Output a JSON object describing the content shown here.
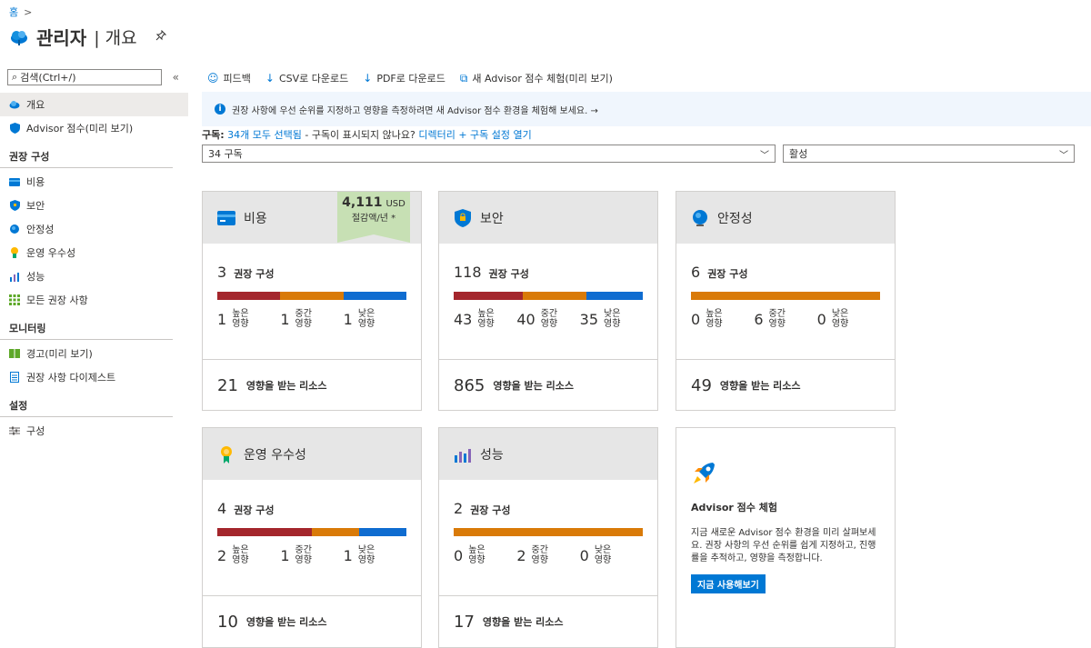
{
  "breadcrumb": {
    "home": "홈",
    "sep": ">"
  },
  "header": {
    "title": "관리자",
    "subtitle": "| 개요"
  },
  "sidebar": {
    "search_placeholder": "검색(Ctrl+/)",
    "collapse": "«",
    "top_items": [
      {
        "label": "개요"
      },
      {
        "label": "Advisor 점수(미리 보기)"
      }
    ],
    "sections": [
      {
        "title": "권장 구성",
        "items": [
          "비용",
          "보안",
          "안정성",
          "운영 우수성",
          "성능",
          "모든 권장 사항"
        ]
      },
      {
        "title": "모니터링",
        "items": [
          "경고(미리 보기)",
          "권장 사항 다이제스트"
        ]
      },
      {
        "title": "설정",
        "items": [
          "구성"
        ]
      }
    ]
  },
  "toolbar": {
    "feedback": "피드백",
    "csv": "CSV로 다운로드",
    "pdf": "PDF로 다운로드",
    "score": "새 Advisor 점수 체험(미리 보기)"
  },
  "banner": {
    "text": "권장 사항에 우선 순위를 지정하고 영향을 측정하려면 새 Advisor 점수 환경을 체험해 보세요. →"
  },
  "subscription": {
    "label": "구독:",
    "selected": "34개 모두 선택됨",
    "question": " - 구독이 표시되지 않나요? ",
    "link": "디렉터리 + 구독 설정 열기",
    "dropdown": "34 구독",
    "status": "활성"
  },
  "colors": {
    "high": "#a4262c",
    "medium": "#d97a08",
    "low": "#0f6cd0",
    "accent": "#0078d4"
  },
  "cards": [
    {
      "title": "비용",
      "count": "3",
      "count_label": "권장 구성",
      "high": "1",
      "medium": "1",
      "low": "1",
      "resources": "21",
      "resources_label": "영향을 받는 리소스",
      "bar": [
        1,
        1,
        1
      ]
    },
    {
      "title": "보안",
      "count": "118",
      "count_label": "권장 구성",
      "high": "43",
      "medium": "40",
      "low": "35",
      "resources": "865",
      "resources_label": "영향을 받는 리소스",
      "bar": [
        43,
        40,
        35
      ]
    },
    {
      "title": "안정성",
      "count": "6",
      "count_label": "권장 구성",
      "high": "0",
      "medium": "6",
      "low": "0",
      "resources": "49",
      "resources_label": "영향을 받는 리소스",
      "bar": [
        0,
        6,
        0
      ]
    },
    {
      "title": "운영 우수성",
      "count": "4",
      "count_label": "권장 구성",
      "high": "2",
      "medium": "1",
      "low": "1",
      "resources": "10",
      "resources_label": "영향을 받는 리소스",
      "bar": [
        2,
        1,
        1
      ]
    },
    {
      "title": "성능",
      "count": "2",
      "count_label": "권장 구성",
      "high": "0",
      "medium": "2",
      "low": "0",
      "resources": "17",
      "resources_label": "영향을 받는 리소스",
      "bar": [
        0,
        2,
        0
      ]
    }
  ],
  "impact_labels": {
    "high": "높은 영향",
    "medium": "중간 영향",
    "low": "낮은 영향"
  },
  "savings": {
    "amount": "4,111",
    "currency": "USD",
    "label": "절감액/년 *"
  },
  "promo": {
    "title": "Advisor 점수 체험",
    "body": "지금 새로운 Advisor 점수 환경을 미리 살펴보세요. 권장 사항의 우선 순위를 쉽게 지정하고, 진행률을 추적하고, 영향을 측정합니다.",
    "button": "지금 사용해보기"
  }
}
